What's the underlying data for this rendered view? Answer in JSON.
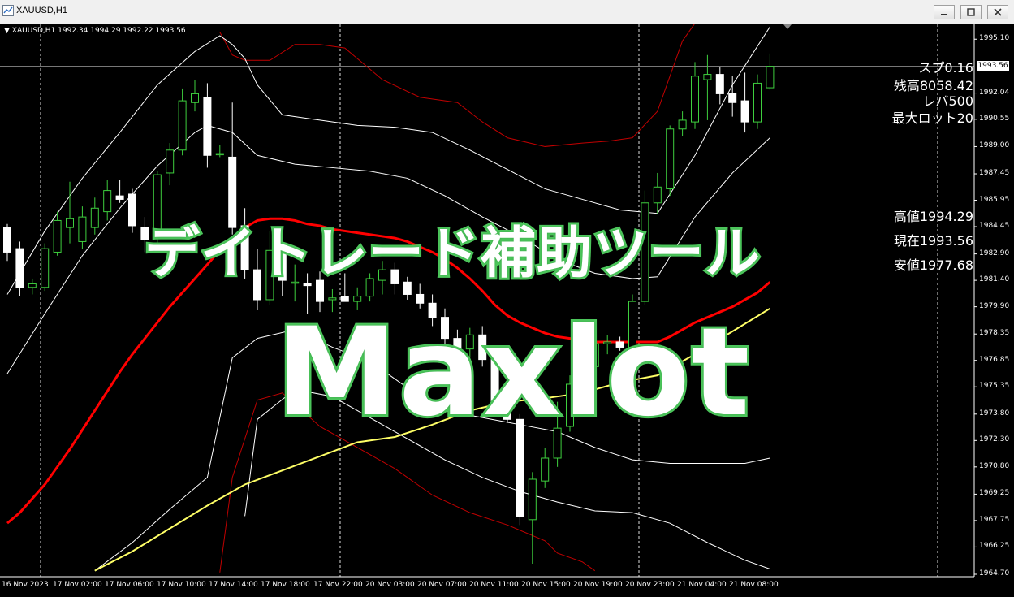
{
  "window": {
    "title": "XAUUSD,H1"
  },
  "chart": {
    "symbol_line": "XAUUSD,H1  1992.34 1994.29 1992.22 1993.56",
    "current_price_tag": "1993.56",
    "colors": {
      "background": "#000000",
      "bull": "#3ecf3e",
      "bear": "#ffffff",
      "ma_red": "#ff0000",
      "ma_yellow": "#ffff66",
      "band_white": "#ffffff",
      "band_red": "#c00000",
      "title_outline": "#4ec85d"
    }
  },
  "price_axis": [
    "1995.10",
    "1993.56",
    "1992.04",
    "1990.55",
    "1989.00",
    "1987.45",
    "1985.95",
    "1984.45",
    "1982.90",
    "1981.40",
    "1979.90",
    "1978.35",
    "1976.85",
    "1975.35",
    "1973.80",
    "1972.30",
    "1970.80",
    "1969.25",
    "1967.75",
    "1966.25",
    "1964.70"
  ],
  "time_axis": [
    "16 Nov 2023",
    "17 Nov 02:00",
    "17 Nov 06:00",
    "17 Nov 10:00",
    "17 Nov 14:00",
    "17 Nov 18:00",
    "17 Nov 22:00",
    "20 Nov 03:00",
    "20 Nov 07:00",
    "20 Nov 11:00",
    "20 Nov 15:00",
    "20 Nov 19:00",
    "20 Nov 23:00",
    "21 Nov 04:00",
    "21 Nov 08:00"
  ],
  "info_panel": {
    "spread": "スプ0.16",
    "balance": "残高8058.42",
    "leverage": "レバ500",
    "max_lot": "最大ロット20",
    "high": "高値1994.29",
    "current": "現在1993.56",
    "low": "安値1977.68"
  },
  "overlay": {
    "title_jp": "デイトレード補助ツール",
    "title_en": "Maxlot"
  },
  "chart_data": {
    "type": "candlestick",
    "x_unit": "hourly bars",
    "ylim": [
      1964.7,
      1995.85
    ],
    "candles": [
      {
        "o": 1984.4,
        "h": 1984.6,
        "l": 1982.5,
        "c": 1983.0
      },
      {
        "o": 1983.2,
        "h": 1983.6,
        "l": 1980.5,
        "c": 1981.0
      },
      {
        "o": 1981.0,
        "h": 1981.5,
        "l": 1980.6,
        "c": 1981.2
      },
      {
        "o": 1981.0,
        "h": 1983.5,
        "l": 1980.8,
        "c": 1983.2
      },
      {
        "o": 1983.0,
        "h": 1985.3,
        "l": 1982.8,
        "c": 1984.8
      },
      {
        "o": 1984.4,
        "h": 1987.0,
        "l": 1983.5,
        "c": 1984.9
      },
      {
        "o": 1983.6,
        "h": 1985.6,
        "l": 1983.2,
        "c": 1985.0
      },
      {
        "o": 1984.4,
        "h": 1986.1,
        "l": 1984.0,
        "c": 1985.5
      },
      {
        "o": 1985.3,
        "h": 1987.1,
        "l": 1984.8,
        "c": 1986.5
      },
      {
        "o": 1986.2,
        "h": 1987.1,
        "l": 1985.8,
        "c": 1986.0
      },
      {
        "o": 1986.3,
        "h": 1986.6,
        "l": 1984.1,
        "c": 1984.5
      },
      {
        "o": 1984.4,
        "h": 1985.0,
        "l": 1983.0,
        "c": 1983.7
      },
      {
        "o": 1983.8,
        "h": 1987.6,
        "l": 1983.2,
        "c": 1987.4
      },
      {
        "o": 1987.5,
        "h": 1989.2,
        "l": 1986.8,
        "c": 1988.8
      },
      {
        "o": 1988.8,
        "h": 1992.3,
        "l": 1988.5,
        "c": 1991.6
      },
      {
        "o": 1991.5,
        "h": 1992.8,
        "l": 1991.0,
        "c": 1992.0
      },
      {
        "o": 1991.8,
        "h": 1992.6,
        "l": 1987.8,
        "c": 1988.5
      },
      {
        "o": 1988.6,
        "h": 1989.1,
        "l": 1988.4,
        "c": 1988.6
      },
      {
        "o": 1988.4,
        "h": 1991.5,
        "l": 1984.0,
        "c": 1984.4
      },
      {
        "o": 1984.5,
        "h": 1985.5,
        "l": 1981.5,
        "c": 1982.0
      },
      {
        "o": 1982.0,
        "h": 1983.2,
        "l": 1979.7,
        "c": 1980.3
      },
      {
        "o": 1980.3,
        "h": 1984.2,
        "l": 1980.0,
        "c": 1983.1
      },
      {
        "o": 1983.0,
        "h": 1983.6,
        "l": 1980.5,
        "c": 1981.4
      },
      {
        "o": 1981.3,
        "h": 1982.3,
        "l": 1980.2,
        "c": 1981.3
      },
      {
        "o": 1981.2,
        "h": 1981.8,
        "l": 1979.5,
        "c": 1981.1
      },
      {
        "o": 1981.4,
        "h": 1981.9,
        "l": 1979.6,
        "c": 1980.2
      },
      {
        "o": 1980.3,
        "h": 1980.9,
        "l": 1979.6,
        "c": 1980.4
      },
      {
        "o": 1980.5,
        "h": 1981.8,
        "l": 1980.2,
        "c": 1980.2
      },
      {
        "o": 1980.2,
        "h": 1981.0,
        "l": 1979.7,
        "c": 1980.5
      },
      {
        "o": 1980.5,
        "h": 1981.8,
        "l": 1980.2,
        "c": 1981.5
      },
      {
        "o": 1981.4,
        "h": 1982.5,
        "l": 1980.6,
        "c": 1982.0
      },
      {
        "o": 1982.0,
        "h": 1982.4,
        "l": 1980.6,
        "c": 1981.2
      },
      {
        "o": 1981.3,
        "h": 1981.6,
        "l": 1980.3,
        "c": 1980.6
      },
      {
        "o": 1980.6,
        "h": 1981.2,
        "l": 1979.8,
        "c": 1980.1
      },
      {
        "o": 1980.1,
        "h": 1980.6,
        "l": 1978.8,
        "c": 1979.3
      },
      {
        "o": 1979.3,
        "h": 1979.8,
        "l": 1977.8,
        "c": 1978.1
      },
      {
        "o": 1978.1,
        "h": 1978.6,
        "l": 1976.9,
        "c": 1977.5
      },
      {
        "o": 1977.5,
        "h": 1978.7,
        "l": 1977.0,
        "c": 1978.3
      },
      {
        "o": 1978.3,
        "h": 1978.8,
        "l": 1976.5,
        "c": 1976.9
      },
      {
        "o": 1976.9,
        "h": 1977.5,
        "l": 1973.9,
        "c": 1974.4
      },
      {
        "o": 1974.4,
        "h": 1974.9,
        "l": 1973.3,
        "c": 1973.5
      },
      {
        "o": 1973.5,
        "h": 1973.8,
        "l": 1967.5,
        "c": 1968.0
      },
      {
        "o": 1967.8,
        "h": 1970.5,
        "l": 1965.3,
        "c": 1970.1
      },
      {
        "o": 1970.0,
        "h": 1971.9,
        "l": 1969.6,
        "c": 1971.3
      },
      {
        "o": 1971.3,
        "h": 1974.5,
        "l": 1970.8,
        "c": 1973.0
      },
      {
        "o": 1973.1,
        "h": 1976.0,
        "l": 1972.8,
        "c": 1975.5
      },
      {
        "o": 1975.6,
        "h": 1977.0,
        "l": 1974.8,
        "c": 1976.5
      },
      {
        "o": 1976.5,
        "h": 1978.7,
        "l": 1976.1,
        "c": 1977.8
      },
      {
        "o": 1977.8,
        "h": 1978.3,
        "l": 1977.2,
        "c": 1977.9
      },
      {
        "o": 1977.9,
        "h": 1978.2,
        "l": 1977.4,
        "c": 1977.6
      },
      {
        "o": 1977.6,
        "h": 1980.6,
        "l": 1977.3,
        "c": 1980.2
      },
      {
        "o": 1980.2,
        "h": 1986.5,
        "l": 1980.0,
        "c": 1985.8
      },
      {
        "o": 1985.8,
        "h": 1987.5,
        "l": 1985.2,
        "c": 1986.7
      },
      {
        "o": 1986.6,
        "h": 1990.2,
        "l": 1986.2,
        "c": 1990.0
      },
      {
        "o": 1990.0,
        "h": 1991.0,
        "l": 1989.6,
        "c": 1990.5
      },
      {
        "o": 1990.4,
        "h": 1993.8,
        "l": 1990.0,
        "c": 1993.0
      },
      {
        "o": 1992.8,
        "h": 1994.2,
        "l": 1990.5,
        "c": 1993.1
      },
      {
        "o": 1993.1,
        "h": 1993.5,
        "l": 1991.4,
        "c": 1992.0
      },
      {
        "o": 1992.0,
        "h": 1993.0,
        "l": 1990.7,
        "c": 1991.5
      },
      {
        "o": 1991.6,
        "h": 1993.2,
        "l": 1989.8,
        "c": 1990.4
      },
      {
        "o": 1990.4,
        "h": 1993.1,
        "l": 1990.0,
        "c": 1992.6
      },
      {
        "o": 1992.34,
        "h": 1994.29,
        "l": 1992.22,
        "c": 1993.56
      }
    ],
    "ma_red": [
      [
        0,
        1967.6
      ],
      [
        1,
        1968.2
      ],
      [
        2,
        1969.0
      ],
      [
        3,
        1969.8
      ],
      [
        4,
        1970.8
      ],
      [
        5,
        1971.8
      ],
      [
        6,
        1972.9
      ],
      [
        7,
        1974.0
      ],
      [
        8,
        1975.1
      ],
      [
        9,
        1976.2
      ],
      [
        10,
        1977.2
      ],
      [
        11,
        1978.1
      ],
      [
        12,
        1979.0
      ],
      [
        13,
        1979.9
      ],
      [
        14,
        1980.7
      ],
      [
        15,
        1981.5
      ],
      [
        16,
        1982.3
      ],
      [
        17,
        1983.1
      ],
      [
        18,
        1983.8
      ],
      [
        19,
        1984.4
      ],
      [
        20,
        1984.8
      ],
      [
        21,
        1984.9
      ],
      [
        22,
        1984.9
      ],
      [
        23,
        1984.8
      ],
      [
        24,
        1984.6
      ],
      [
        25,
        1984.5
      ],
      [
        26,
        1984.3
      ],
      [
        27,
        1984.2
      ],
      [
        28,
        1984.1
      ],
      [
        29,
        1984.0
      ],
      [
        30,
        1983.9
      ],
      [
        31,
        1983.8
      ],
      [
        32,
        1983.6
      ],
      [
        33,
        1983.3
      ],
      [
        34,
        1983.0
      ],
      [
        35,
        1982.6
      ],
      [
        36,
        1982.1
      ],
      [
        37,
        1981.5
      ],
      [
        38,
        1980.8
      ],
      [
        39,
        1980.0
      ],
      [
        40,
        1979.4
      ],
      [
        41,
        1979.0
      ],
      [
        42,
        1978.7
      ],
      [
        43,
        1978.4
      ],
      [
        44,
        1978.2
      ],
      [
        45,
        1978.1
      ],
      [
        46,
        1978.0
      ],
      [
        47,
        1977.9
      ],
      [
        48,
        1977.9
      ],
      [
        49,
        1977.9
      ],
      [
        50,
        1977.9
      ],
      [
        51,
        1977.9
      ],
      [
        52,
        1977.9
      ],
      [
        53,
        1978.2
      ],
      [
        54,
        1978.6
      ],
      [
        55,
        1979.0
      ],
      [
        56,
        1979.3
      ],
      [
        57,
        1979.6
      ],
      [
        58,
        1979.9
      ],
      [
        59,
        1980.3
      ],
      [
        60,
        1980.7
      ],
      [
        61,
        1981.3
      ]
    ],
    "ma_yellow": [
      [
        7,
        1964.9
      ],
      [
        10,
        1966.0
      ],
      [
        13,
        1967.3
      ],
      [
        16,
        1968.6
      ],
      [
        19,
        1969.8
      ],
      [
        22,
        1970.6
      ],
      [
        25,
        1971.4
      ],
      [
        28,
        1972.2
      ],
      [
        31,
        1972.5
      ],
      [
        34,
        1973.2
      ],
      [
        37,
        1974.0
      ],
      [
        40,
        1974.5
      ],
      [
        43,
        1974.7
      ],
      [
        46,
        1975.0
      ],
      [
        49,
        1975.6
      ],
      [
        52,
        1976.0
      ],
      [
        55,
        1977.2
      ],
      [
        58,
        1978.5
      ],
      [
        61,
        1979.8
      ]
    ],
    "band_white_upper_outer": [
      [
        0,
        1980.6
      ],
      [
        3,
        1984.2
      ],
      [
        6,
        1987.2
      ],
      [
        9,
        1989.8
      ],
      [
        12,
        1992.5
      ],
      [
        15,
        1994.4
      ],
      [
        17,
        1995.3
      ],
      [
        18,
        1994.8
      ],
      [
        19,
        1994.0
      ],
      [
        20,
        1992.5
      ],
      [
        22,
        1990.8
      ],
      [
        25,
        1990.5
      ],
      [
        28,
        1990.2
      ],
      [
        31,
        1990.1
      ],
      [
        34,
        1989.8
      ],
      [
        37,
        1988.8
      ],
      [
        40,
        1987.7
      ],
      [
        43,
        1986.6
      ],
      [
        46,
        1986.0
      ],
      [
        49,
        1985.4
      ],
      [
        52,
        1985.2
      ],
      [
        55,
        1988.5
      ],
      [
        58,
        1992.5
      ],
      [
        61,
        1995.8
      ]
    ],
    "band_white_upper_inner": [
      [
        0,
        1976.1
      ],
      [
        3,
        1979.5
      ],
      [
        6,
        1982.8
      ],
      [
        9,
        1985.5
      ],
      [
        12,
        1987.9
      ],
      [
        15,
        1989.8
      ],
      [
        16,
        1990.2
      ],
      [
        18,
        1989.8
      ],
      [
        20,
        1988.5
      ],
      [
        23,
        1988.0
      ],
      [
        26,
        1987.8
      ],
      [
        29,
        1987.6
      ],
      [
        32,
        1987.2
      ],
      [
        35,
        1986.2
      ],
      [
        38,
        1985.0
      ],
      [
        41,
        1983.9
      ],
      [
        44,
        1982.6
      ],
      [
        47,
        1981.8
      ],
      [
        50,
        1981.5
      ],
      [
        52,
        1981.6
      ],
      [
        55,
        1985.0
      ],
      [
        58,
        1987.5
      ],
      [
        61,
        1989.5
      ]
    ],
    "band_white_lower_inner": [
      [
        7,
        1964.9
      ],
      [
        10,
        1966.5
      ],
      [
        13,
        1968.4
      ],
      [
        16,
        1970.2
      ],
      [
        18,
        1977.0
      ],
      [
        20,
        1978.1
      ],
      [
        23,
        1978.6
      ],
      [
        26,
        1977.6
      ],
      [
        29,
        1976.8
      ],
      [
        32,
        1975.3
      ],
      [
        35,
        1974.0
      ],
      [
        38,
        1973.6
      ],
      [
        41,
        1973.2
      ],
      [
        44,
        1972.8
      ],
      [
        47,
        1971.9
      ],
      [
        50,
        1971.2
      ],
      [
        53,
        1971.0
      ],
      [
        56,
        1971.0
      ],
      [
        59,
        1971.0
      ],
      [
        61,
        1971.3
      ]
    ],
    "band_white_lower_outer": [
      [
        19,
        1968.0
      ],
      [
        20,
        1973.5
      ],
      [
        23,
        1975.2
      ],
      [
        26,
        1974.8
      ],
      [
        29,
        1973.6
      ],
      [
        32,
        1972.4
      ],
      [
        35,
        1971.2
      ],
      [
        38,
        1970.2
      ],
      [
        41,
        1969.4
      ],
      [
        44,
        1968.8
      ],
      [
        47,
        1968.3
      ],
      [
        50,
        1968.2
      ],
      [
        53,
        1967.6
      ],
      [
        56,
        1966.5
      ],
      [
        59,
        1965.5
      ],
      [
        61,
        1965.0
      ]
    ],
    "band_red_upper": [
      [
        17,
        1995.5
      ],
      [
        18,
        1994.2
      ],
      [
        19,
        1993.9
      ],
      [
        21,
        1993.9
      ],
      [
        23,
        1994.8
      ],
      [
        25,
        1994.8
      ],
      [
        27,
        1994.6
      ],
      [
        30,
        1992.8
      ],
      [
        33,
        1991.8
      ],
      [
        36,
        1991.5
      ],
      [
        38,
        1990.4
      ],
      [
        40,
        1989.5
      ],
      [
        43,
        1989.0
      ],
      [
        46,
        1989.2
      ],
      [
        48,
        1989.3
      ],
      [
        50,
        1989.5
      ],
      [
        52,
        1991.0
      ],
      [
        54,
        1995.0
      ],
      [
        55,
        1996.0
      ]
    ],
    "band_red_lower": [
      [
        17,
        1964.8
      ],
      [
        18,
        1970.2
      ],
      [
        20,
        1974.6
      ],
      [
        22,
        1975.0
      ],
      [
        25,
        1973.1
      ],
      [
        28,
        1971.9
      ],
      [
        31,
        1970.7
      ],
      [
        34,
        1969.2
      ],
      [
        37,
        1968.2
      ],
      [
        40,
        1967.5
      ],
      [
        43,
        1966.6
      ],
      [
        44,
        1965.9
      ],
      [
        46,
        1965.4
      ],
      [
        47,
        1964.9
      ]
    ]
  }
}
